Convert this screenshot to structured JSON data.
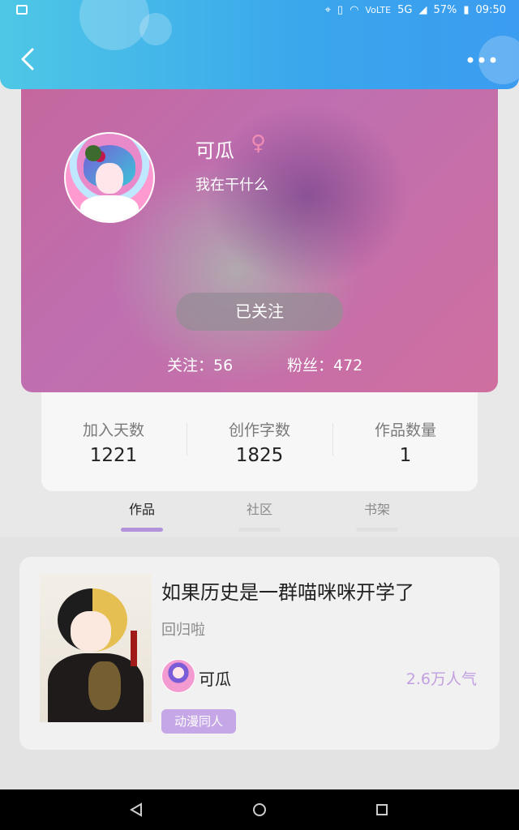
{
  "status_bar": {
    "network": "5G",
    "volte": "VoLTE",
    "battery": "57%",
    "time": "09:50"
  },
  "header": {
    "back_icon": "chevron-left-icon",
    "more_icon": "more-dots-icon"
  },
  "profile": {
    "name": "可瓜",
    "gender_symbol": "♀",
    "bio": "我在干什么",
    "follow_button": "已关注",
    "following": "关注：56",
    "followers": "粉丝：472"
  },
  "stats": [
    {
      "label": "加入天数",
      "value": "1221"
    },
    {
      "label": "创作字数",
      "value": "1825"
    },
    {
      "label": "作品数量",
      "value": "1"
    }
  ],
  "tabs": [
    {
      "label": "作品",
      "active": true
    },
    {
      "label": "社区",
      "active": false
    },
    {
      "label": "书架",
      "active": false
    }
  ],
  "work": {
    "title": "如果历史是一群喵咪咪开学了",
    "description": "回归啦",
    "author": "可瓜",
    "popularity": "2.6万人气",
    "tag": "动漫同人"
  },
  "colors": {
    "header": "#3aa6ec",
    "accent": "#b292da",
    "tag": "#c5a6e6",
    "gender": "#f08bb3"
  }
}
